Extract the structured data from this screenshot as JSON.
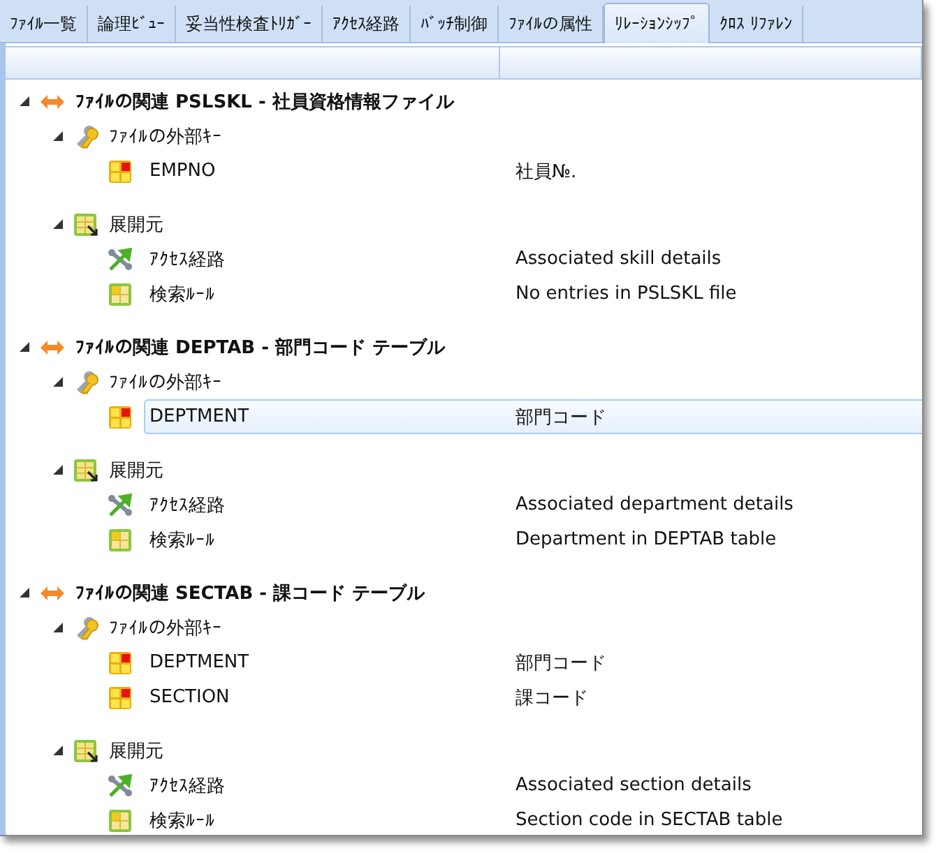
{
  "tabs": [
    {
      "label": "ﾌｧｲﾙ一覧",
      "selected": false
    },
    {
      "label": "論理ﾋﾞｭｰ",
      "selected": false
    },
    {
      "label": "妥当性検査ﾄﾘｶﾞｰ",
      "selected": false
    },
    {
      "label": "ｱｸｾｽ経路",
      "selected": false
    },
    {
      "label": "ﾊﾞｯﾁ制御",
      "selected": false
    },
    {
      "label": "ﾌｧｲﾙの属性",
      "selected": false
    },
    {
      "label": "ﾘﾚｰｼｮﾝｼｯﾌﾟ",
      "selected": true
    },
    {
      "label": "ｸﾛｽ ﾘﾌｧﾚﾝ",
      "selected": false
    }
  ],
  "tree": [
    {
      "label": "ﾌｧｲﾙの関連 PSLSKL - 社員資格情報ファイル",
      "expanded": true,
      "sections": [
        {
          "kind": "foreign-key",
          "label": "ﾌｧｲﾙの外部ｷｰ",
          "expanded": true,
          "items": [
            {
              "kind": "field",
              "name": "EMPNO",
              "description": "社員№.",
              "selected": false
            }
          ]
        },
        {
          "kind": "expansion",
          "label": "展開元",
          "expanded": true,
          "items": [
            {
              "kind": "access-path",
              "name": "ｱｸｾｽ経路",
              "description": "Associated skill details",
              "selected": false
            },
            {
              "kind": "search-rule",
              "name": "検索ﾙｰﾙ",
              "description": "No entries in PSLSKL file",
              "selected": false
            }
          ]
        }
      ]
    },
    {
      "label": "ﾌｧｲﾙの関連 DEPTAB - 部門コード テーブル",
      "expanded": true,
      "sections": [
        {
          "kind": "foreign-key",
          "label": "ﾌｧｲﾙの外部ｷｰ",
          "expanded": true,
          "items": [
            {
              "kind": "field",
              "name": "DEPTMENT",
              "description": "部門コード",
              "selected": true
            }
          ]
        },
        {
          "kind": "expansion",
          "label": "展開元",
          "expanded": true,
          "items": [
            {
              "kind": "access-path",
              "name": "ｱｸｾｽ経路",
              "description": "Associated department details",
              "selected": false
            },
            {
              "kind": "search-rule",
              "name": "検索ﾙｰﾙ",
              "description": "Department in DEPTAB table",
              "selected": false
            }
          ]
        }
      ]
    },
    {
      "label": "ﾌｧｲﾙの関連 SECTAB - 課コード テーブル",
      "expanded": true,
      "sections": [
        {
          "kind": "foreign-key",
          "label": "ﾌｧｲﾙの外部ｷｰ",
          "expanded": true,
          "items": [
            {
              "kind": "field",
              "name": "DEPTMENT",
              "description": "部門コード",
              "selected": false
            },
            {
              "kind": "field",
              "name": "SECTION",
              "description": "課コード",
              "selected": false
            }
          ]
        },
        {
          "kind": "expansion",
          "label": "展開元",
          "expanded": true,
          "items": [
            {
              "kind": "access-path",
              "name": "ｱｸｾｽ経路",
              "description": "Associated section details",
              "selected": false
            },
            {
              "kind": "search-rule",
              "name": "検索ﾙｰﾙ",
              "description": "Section code in SECTAB table",
              "selected": false
            }
          ]
        }
      ]
    }
  ]
}
